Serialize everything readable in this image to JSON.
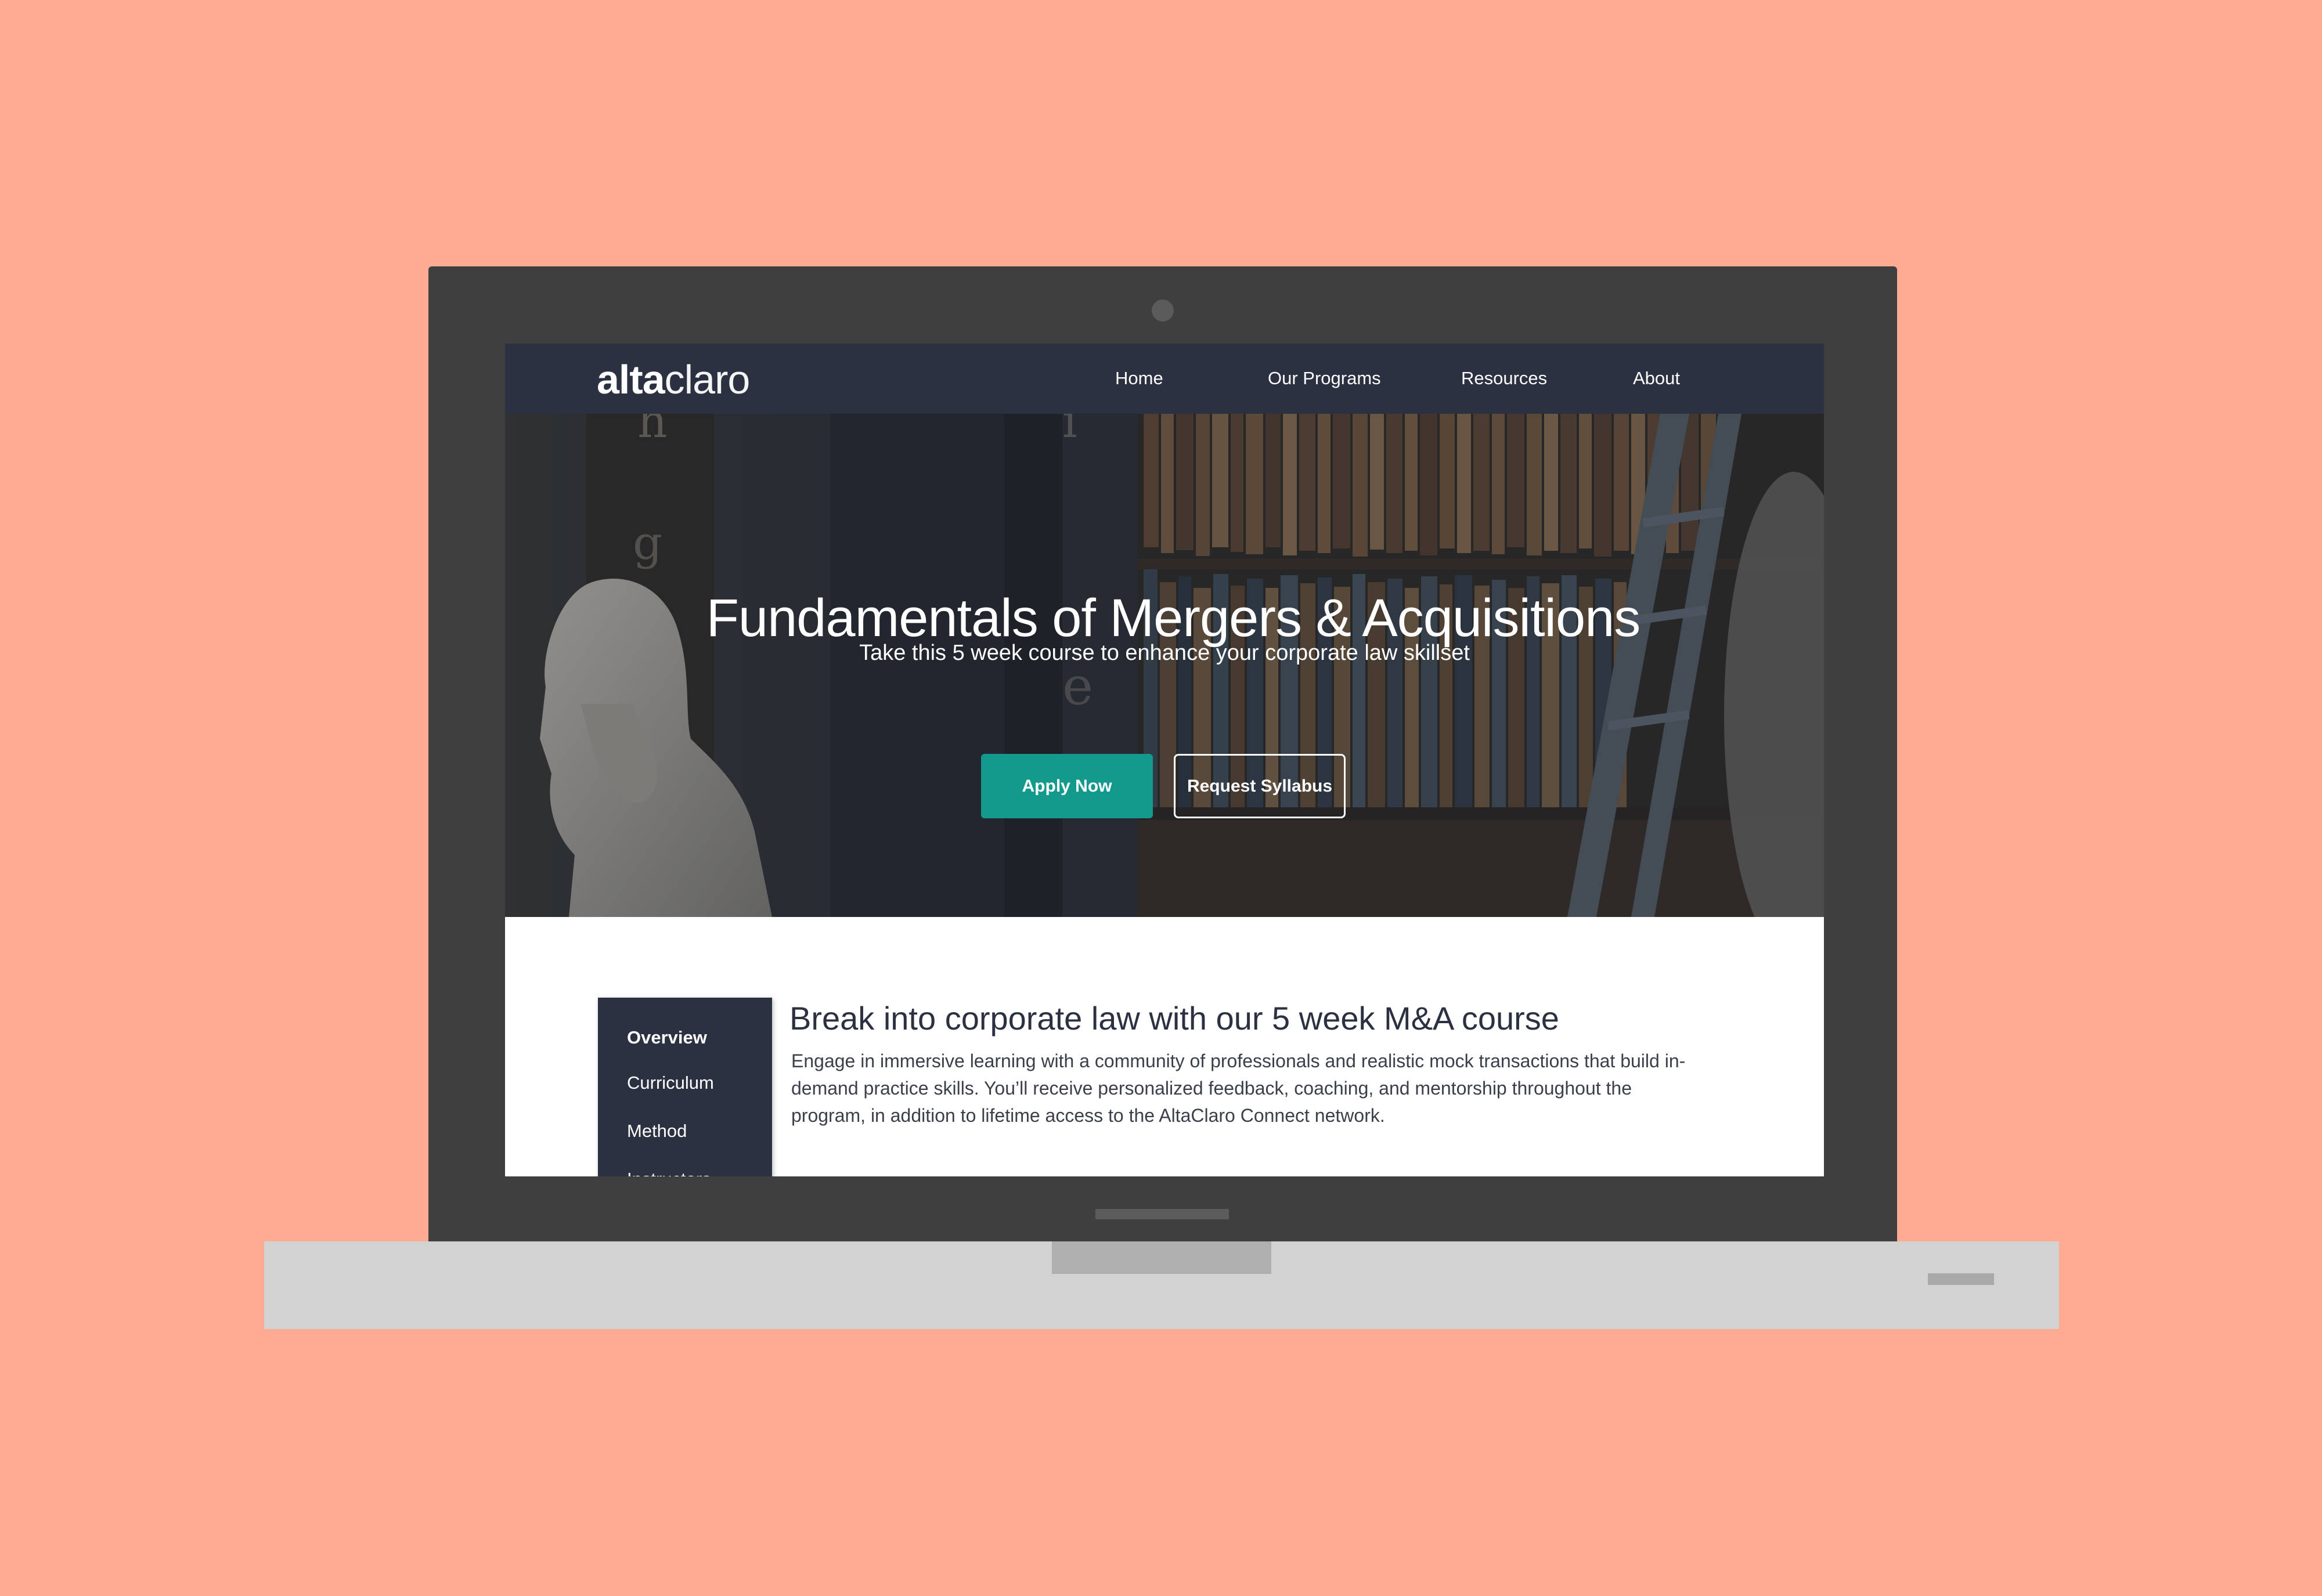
{
  "brand": {
    "logo_bold": "alta",
    "logo_light": "claro"
  },
  "nav": {
    "items": [
      {
        "label": "Home"
      },
      {
        "label": "Our Programs"
      },
      {
        "label": "Resources"
      },
      {
        "label": "About"
      }
    ]
  },
  "hero": {
    "title": "Fundamentals of Mergers & Acquisitions",
    "subtitle": "Take this 5 week course to enhance your corporate law skillset",
    "apply_label": "Apply Now",
    "syllabus_label": "Request Syllabus"
  },
  "side_nav": {
    "items": [
      {
        "label": "Overview"
      },
      {
        "label": "Curriculum"
      },
      {
        "label": "Method"
      },
      {
        "label": "Instructors"
      }
    ]
  },
  "content": {
    "heading": "Break into corporate law with our 5 week M&A course",
    "body": "Engage in immersive learning with a community of professionals and realistic mock transactions that build in-demand practice skills.  You’ll receive personalized feedback, coaching, and mentorship throughout the program, in addition to lifetime access to the AltaClaro Connect network."
  },
  "colors": {
    "background": "#FFAA92",
    "navbar": "#2B3140",
    "accent": "#139A8C",
    "bezel": "#3F3F3F"
  }
}
